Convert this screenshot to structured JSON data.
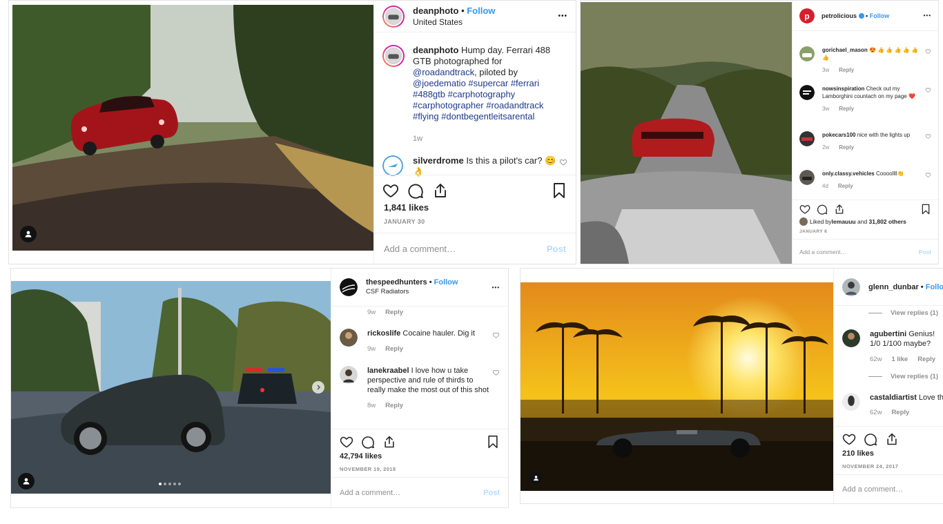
{
  "post1": {
    "username": "deanphoto",
    "follow": "Follow",
    "location": "United States",
    "more": "•••",
    "caption_user": "deanphoto",
    "caption_text1": " Hump day. Ferrari 488 GTB photographed for ",
    "caption_mention1": "@roadandtrack",
    "caption_text2": ", piloted by ",
    "caption_tags": "@joedematio #supercar #ferrari #488gtb #carphotography #carphotographer #roadandtrack #flying #dontbegentleitsarental",
    "caption_time": "1w",
    "comment_user": "silverdrome",
    "comment_text": " Is this a pilot's car? 😊 👌",
    "likes": "1,841 likes",
    "date": "JANUARY 30",
    "add_comment": "Add a comment…",
    "post_label": "Post"
  },
  "post2": {
    "username": "petrolicious",
    "follow": "Follow",
    "top_meta": "3w  Reply",
    "comments": [
      {
        "user": "gorichael_mason",
        "text": " 😍 👍 👍 👍 👍 👍 👍",
        "time": "3w",
        "reply": "Reply"
      },
      {
        "user": "nowsinspiration",
        "text": " Check out my Lamborghini countach on my page ❤️",
        "time": "3w",
        "reply": "Reply"
      },
      {
        "user": "pokecars100",
        "text": " nice with the lights up",
        "time": "2w",
        "reply": "Reply"
      },
      {
        "user": "only.classy.vehicles",
        "text": " Coooollll👏",
        "time": "4d",
        "reply": "Reply"
      }
    ],
    "liked_by": "Liked by ",
    "liked_user": "lemauuu",
    "liked_and": " and ",
    "liked_others": "31,802 others",
    "date": "JANUARY 8",
    "add_comment": "Add a comment…",
    "post_label": "Post"
  },
  "post3": {
    "username": "thespeedhunters",
    "follow": "Follow",
    "location": "CSF Radiators",
    "more": "•••",
    "top_time": "9w",
    "top_reply": "Reply",
    "comments": [
      {
        "user": "rickoslife",
        "text": " Cocaine hauler. Dig it",
        "time": "9w",
        "reply": "Reply"
      },
      {
        "user": "lanekraabel",
        "text": " I love how u take perspective and rule of thirds to really make the most out of this shot",
        "time": "8w",
        "reply": "Reply"
      }
    ],
    "likes": "42,794 likes",
    "date": "NOVEMBER 19, 2018",
    "add_comment": "Add a comment…",
    "post_label": "Post"
  },
  "post4": {
    "username": "glenn_dunbar",
    "follow": "Follow",
    "view_replies": "View replies (1)",
    "comments": [
      {
        "user": "agubertini",
        "text": " Genius! 1/0 1/100 maybe?",
        "time": "62w",
        "likes": "1 like",
        "reply": "Reply"
      },
      {
        "user": "castaldiartist",
        "text": " Love th",
        "time": "62w",
        "reply": "Reply"
      }
    ],
    "likes": "210 likes",
    "date": "NOVEMBER 24, 2017",
    "add_comment": "Add a comment…"
  },
  "colors": {
    "link": "#3897f0",
    "hashtag": "#1e3a8a",
    "muted": "#8e8e8e"
  }
}
